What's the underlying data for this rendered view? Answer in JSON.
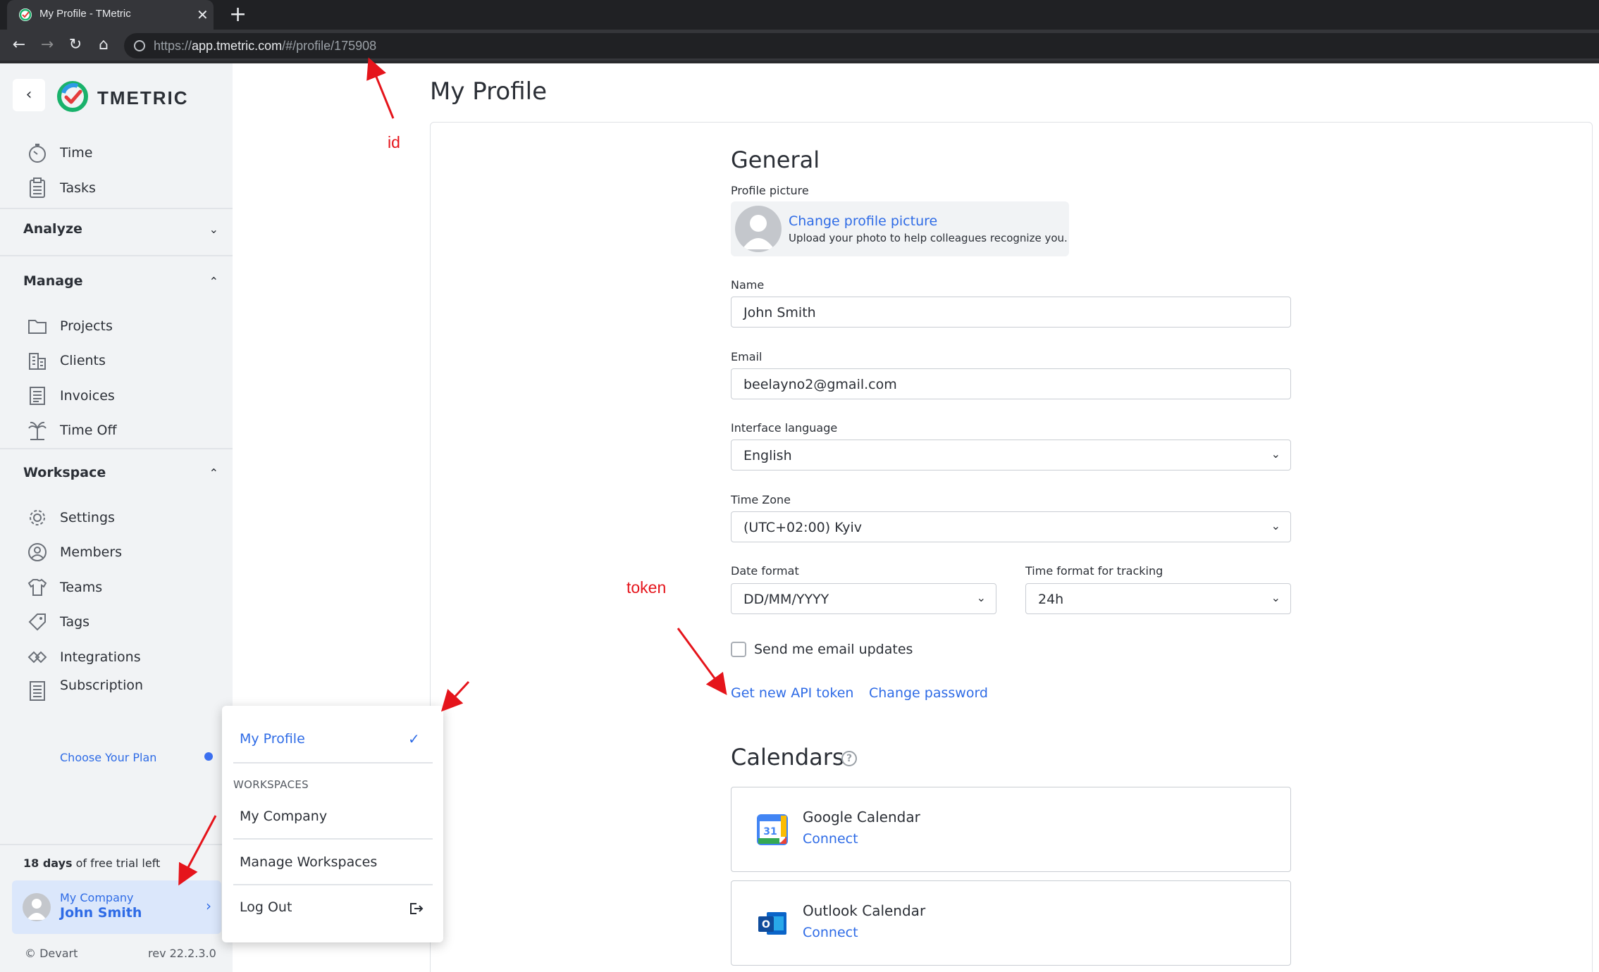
{
  "browser": {
    "tab_title": "My Profile - TMetric",
    "url_scheme": "https://",
    "url_host": "app.tmetric.com",
    "url_path": "/#/profile/175908",
    "icons": [
      "tmetric-favicon",
      "close-icon",
      "plus-icon",
      "back-icon",
      "forward-icon",
      "reload-icon",
      "home-icon",
      "site-info-icon"
    ]
  },
  "sidebar": {
    "brand": "TMETRIC",
    "top_items": [
      {
        "label": "Time",
        "icon": "stopwatch-icon"
      },
      {
        "label": "Tasks",
        "icon": "clipboard-icon"
      }
    ],
    "sections": [
      {
        "label": "Analyze",
        "expanded": false
      },
      {
        "label": "Manage",
        "expanded": true
      },
      {
        "label": "Workspace",
        "expanded": true
      }
    ],
    "manage_items": [
      {
        "label": "Projects",
        "icon": "folder-icon"
      },
      {
        "label": "Clients",
        "icon": "building-icon"
      },
      {
        "label": "Invoices",
        "icon": "invoice-icon"
      },
      {
        "label": "Time Off",
        "icon": "palm-tree-icon"
      }
    ],
    "workspace_items": [
      {
        "label": "Settings",
        "icon": "gear-icon"
      },
      {
        "label": "Members",
        "icon": "user-circle-icon"
      },
      {
        "label": "Teams",
        "icon": "team-shirt-icon"
      },
      {
        "label": "Tags",
        "icon": "tag-icon"
      },
      {
        "label": "Integrations",
        "icon": "integrations-icon"
      },
      {
        "label": "Subscription",
        "icon": "subscription-icon"
      }
    ],
    "subscription_sub": "Choose Your Plan",
    "trial_days": "18 days",
    "trial_rest": "of free trial left",
    "account_company": "My Company",
    "account_user": "John Smith",
    "copyright": "© Devart",
    "rev": "rev 22.2.3.0"
  },
  "main": {
    "page_title": "My Profile",
    "general_heading": "General",
    "profile_picture_label": "Profile picture",
    "change_picture_link": "Change profile picture",
    "change_picture_help": "Upload your photo to help colleagues recognize you.",
    "name_label": "Name",
    "name_value": "John Smith",
    "email_label": "Email",
    "email_value": "beelayno2@gmail.com",
    "language_label": "Interface language",
    "language_value": "English",
    "timezone_label": "Time Zone",
    "timezone_value": "(UTC+02:00) Kyiv",
    "date_format_label": "Date format",
    "date_format_value": "DD/MM/YYYY",
    "time_format_label": "Time format for tracking",
    "time_format_value": "24h",
    "email_updates_label": "Send me email updates",
    "email_updates_checked": false,
    "api_token_link": "Get new API token",
    "change_password_link": "Change password",
    "calendars_heading": "Calendars",
    "calendars": [
      {
        "name": "Google Calendar",
        "action": "Connect",
        "icon": "google-calendar-icon"
      },
      {
        "name": "Outlook Calendar",
        "action": "Connect",
        "icon": "outlook-calendar-icon"
      }
    ]
  },
  "menu": {
    "my_profile": "My Profile",
    "workspaces_header": "WORKSPACES",
    "my_company": "My Company",
    "manage_workspaces": "Manage Workspaces",
    "log_out": "Log Out"
  },
  "annotations": {
    "id_label": "id",
    "token_label": "token",
    "color": "#e5141b"
  },
  "colors": {
    "accent": "#2e6be6",
    "sidebar_bg": "#f1f3f5",
    "account_card_bg": "#dbe7fb"
  }
}
